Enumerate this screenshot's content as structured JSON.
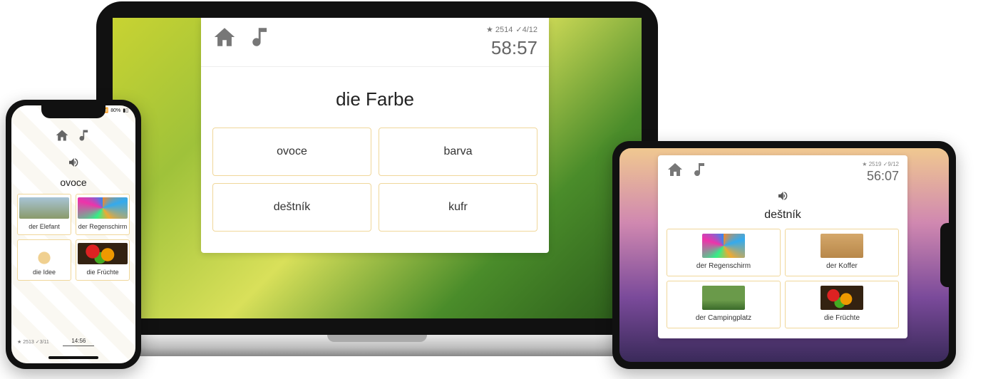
{
  "laptop": {
    "stats": {
      "points": "2514",
      "progress": "4/12"
    },
    "timer": "58:57",
    "prompt": "die Farbe",
    "options": [
      "ovoce",
      "barva",
      "deštník",
      "kufr"
    ]
  },
  "phone": {
    "statusbar": {
      "signal": "📶",
      "battery_pct": "80%",
      "battery": "▮▯"
    },
    "stats": {
      "points": "2513",
      "progress": "3/11"
    },
    "timer": "14:56",
    "prompt": "ovoce",
    "options": [
      {
        "label": "der Elefant",
        "thumb": "th-elephant"
      },
      {
        "label": "der Regenschirm",
        "thumb": "th-umbrella"
      },
      {
        "label": "die Idee",
        "thumb": "th-idea"
      },
      {
        "label": "die Früchte",
        "thumb": "th-fruit"
      }
    ]
  },
  "tablet": {
    "stats": {
      "points": "2519",
      "progress": "9/12"
    },
    "timer": "56:07",
    "prompt": "deštník",
    "options": [
      {
        "label": "der Regenschirm",
        "thumb": "th-umbrella"
      },
      {
        "label": "der Koffer",
        "thumb": "th-koffer"
      },
      {
        "label": "der Campingplatz",
        "thumb": "th-camping"
      },
      {
        "label": "die Früchte",
        "thumb": "th-fruit"
      }
    ]
  }
}
